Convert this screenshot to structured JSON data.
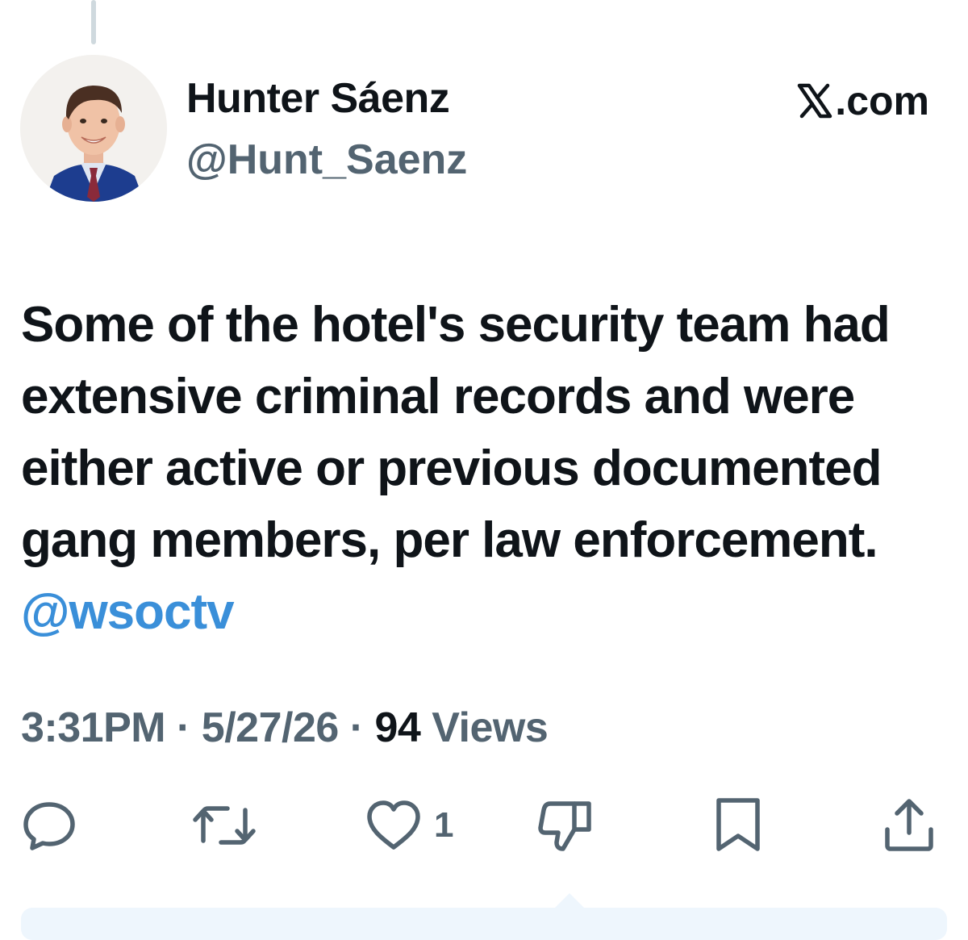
{
  "author": {
    "display_name": "Hunter Sáenz",
    "handle": "@Hunt_Saenz"
  },
  "site": {
    "label": ".com",
    "logo_icon": "x-logo-icon"
  },
  "tweet": {
    "text": "Some of the hotel's security team had extensive criminal records and were either active or previous documented gang members, per law enforcement.",
    "mention": "@wsoctv"
  },
  "meta": {
    "time": "3:31PM",
    "separator_1": " · ",
    "date": "5/27/26",
    "separator_2": " · ",
    "views_count": "94",
    "views_label": " Views"
  },
  "actions": {
    "reply_icon": "speech-bubble-icon",
    "retweet_icon": "retweet-arrows-icon",
    "like_icon": "heart-icon",
    "like_count": "1",
    "dislike_icon": "thumbs-down-icon",
    "bookmark_icon": "bookmark-icon",
    "share_icon": "share-upload-icon"
  },
  "colors": {
    "text_primary": "#0f1419",
    "text_secondary": "#536471",
    "mention": "#3a8fd9",
    "thread_line": "#cfd9de",
    "panel": "#eef6fd"
  }
}
